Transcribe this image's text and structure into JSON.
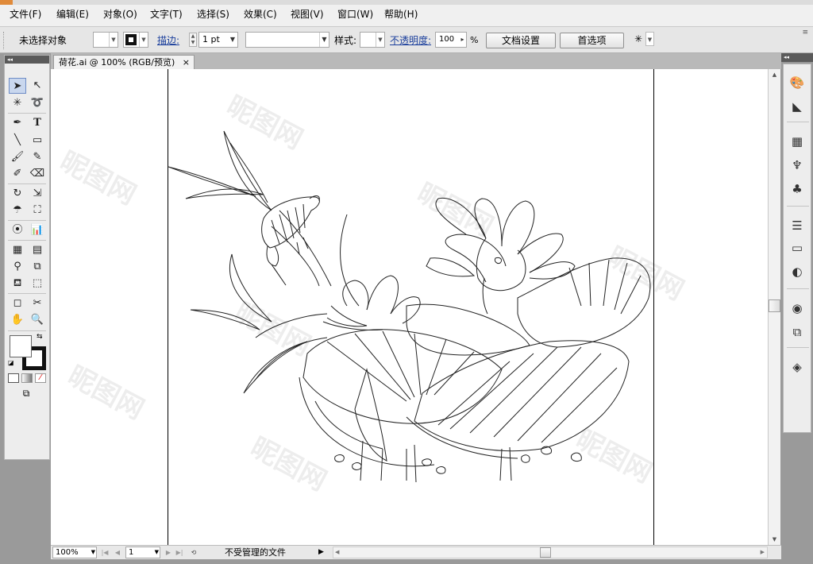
{
  "menu": [
    "文件(F)",
    "编辑(E)",
    "对象(O)",
    "文字(T)",
    "选择(S)",
    "效果(C)",
    "视图(V)",
    "窗口(W)",
    "帮助(H)"
  ],
  "control": {
    "selection_status": "未选择对象",
    "stroke_label": "描边:",
    "stroke_weight": "1 pt",
    "style_label": "样式:",
    "opacity_label": "不透明度:",
    "opacity_value": "100",
    "opacity_unit": "%",
    "doc_setup_button": "文档设置",
    "preferences_button": "首选项"
  },
  "document": {
    "tab_title": "荷花.ai @ 100% (RGB/预览)",
    "close": "×"
  },
  "status": {
    "zoom": "100%",
    "artboard": "1",
    "info": "不受管理的文件"
  },
  "watermark": "昵图网",
  "colors": {
    "fill": "#ffffff",
    "stroke": "#111111",
    "link": "#1b3f9c"
  },
  "tool_icons": [
    "selection-icon",
    "direct-selection-icon",
    "magic-wand-icon",
    "lasso-icon",
    "pen-icon",
    "type-icon",
    "line-icon",
    "rectangle-icon",
    "paintbrush-icon",
    "pencil-icon",
    "blob-brush-icon",
    "eraser-icon",
    "rotate-icon",
    "scale-icon",
    "warp-icon",
    "free-transform-icon",
    "symbol-sprayer-icon",
    "graph-icon",
    "mesh-icon",
    "gradient-icon",
    "eyedropper-icon",
    "blend-icon",
    "live-paint-icon",
    "live-paint-select-icon",
    "artboard-icon",
    "slice-icon",
    "hand-icon",
    "zoom-icon"
  ],
  "dock_icons": [
    "color-palette-icon",
    "color-guide-icon",
    "swatches-icon",
    "brushes-icon",
    "symbols-icon",
    "stroke-icon",
    "gradient-panel-icon",
    "transparency-icon",
    "appearance-icon",
    "graphic-styles-icon",
    "layers-icon"
  ]
}
